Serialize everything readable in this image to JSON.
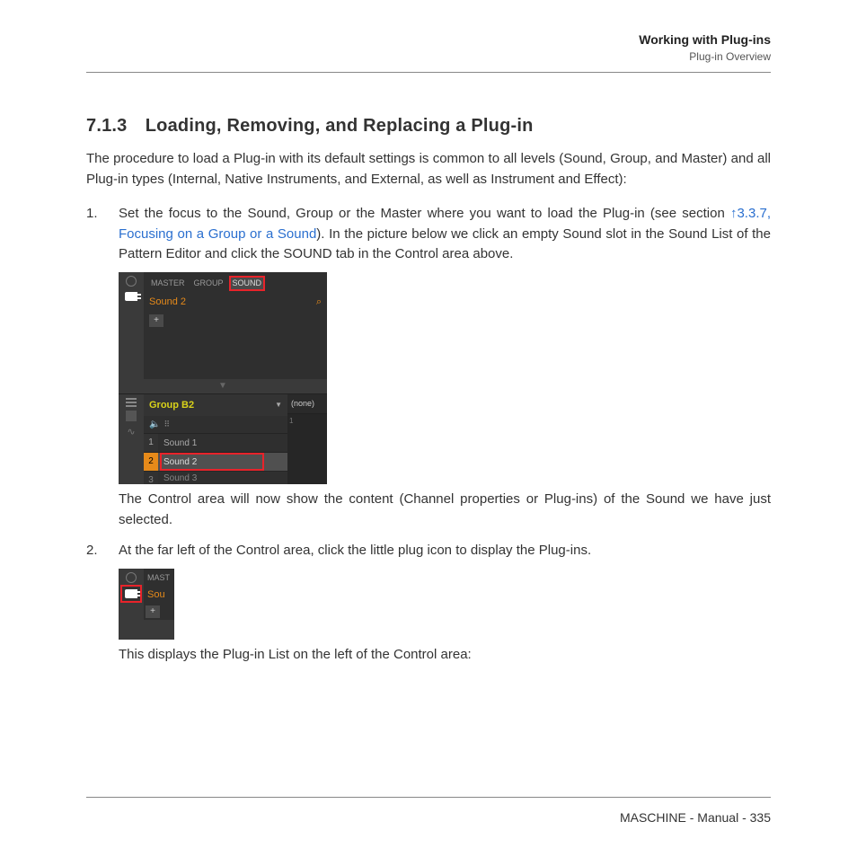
{
  "header": {
    "title": "Working with Plug-ins",
    "subtitle": "Plug-in Overview"
  },
  "section": {
    "number": "7.1.3",
    "title": "Loading, Removing, and Replacing a Plug-in"
  },
  "intro": "The procedure to load a Plug-in with its default settings is common to all levels (Sound, Group, and Master) and all Plug-in types (Internal, Native Instruments, and External, as well as Instrument and Effect):",
  "steps": [
    {
      "pre": "Set the focus to the Sound, Group or the Master where you want to load the Plug-in (see section ",
      "link": "↑3.3.7, Focusing on a Group or a Sound",
      "post": "). In the picture below we click an empty Sound slot in the Sound List of the Pattern Editor and click the SOUND tab in the Control area above.",
      "caption": "The Control area will now show the content (Channel properties or Plug-ins) of the Sound we have just selected."
    },
    {
      "text": "At the far left of the Control area, click the little plug icon to display the Plug-ins.",
      "caption": "This displays the Plug-in List on the left of the Control area:"
    }
  ],
  "screenshot1": {
    "tabs": [
      "MASTER",
      "GROUP",
      "SOUND"
    ],
    "active_tab": "SOUND",
    "sound_name": "Sound 2",
    "plus": "+",
    "group_name": "Group B2",
    "none_label": "(none)",
    "idx1": "1",
    "sounds": [
      {
        "num": "1",
        "name": "Sound 1"
      },
      {
        "num": "2",
        "name": "Sound 2"
      },
      {
        "num": "3",
        "name": "Sound 3"
      }
    ]
  },
  "screenshot2": {
    "tab_fragment": "MAST",
    "sound_fragment": "Sou",
    "plus": "+"
  },
  "footer": "MASCHINE - Manual - 335"
}
